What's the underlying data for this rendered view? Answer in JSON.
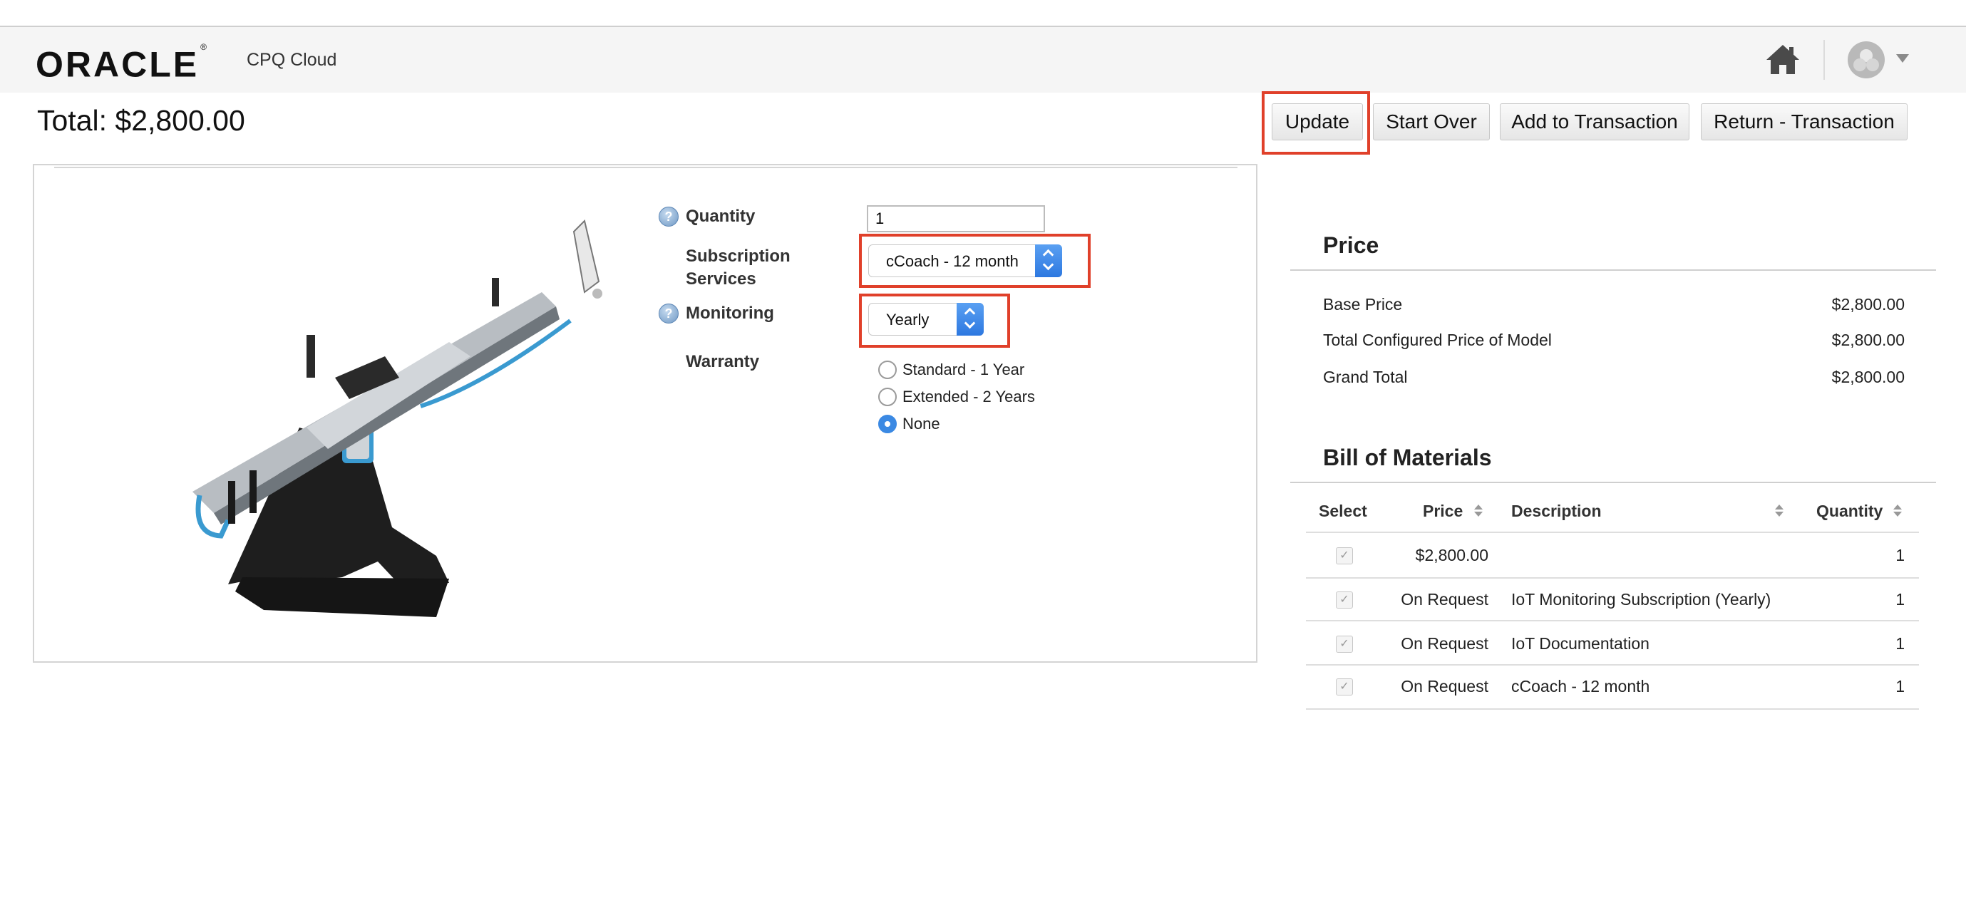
{
  "header": {
    "logo_text": "ORACLE",
    "logo_mark": "®",
    "app_name": "CPQ Cloud",
    "icons": [
      "home-icon",
      "user-avatar-icon",
      "caret-down-icon"
    ]
  },
  "total": {
    "label": "Total: $2,800.00"
  },
  "actions": {
    "update": "Update",
    "start_over": "Start Over",
    "add_to_transaction": "Add to Transaction",
    "return_transaction": "Return - Transaction"
  },
  "config": {
    "quantity_label": "Quantity",
    "quantity_value": "1",
    "subscription_label_1": "Subscription",
    "subscription_label_2": "Services",
    "subscription_value": "cCoach - 12 month",
    "monitoring_label": "Monitoring",
    "monitoring_value": "Yearly",
    "warranty_label": "Warranty",
    "warranty_options": [
      {
        "label": "Standard - 1 Year",
        "selected": false
      },
      {
        "label": "Extended - 2 Years",
        "selected": false
      },
      {
        "label": "None",
        "selected": true
      }
    ],
    "help_icon_glyph": "?"
  },
  "price": {
    "title": "Price",
    "rows": [
      {
        "label": "Base Price",
        "value": "$2,800.00"
      },
      {
        "label": "Total Configured Price of Model",
        "value": "$2,800.00"
      },
      {
        "label": "Grand Total",
        "value": "$2,800.00"
      }
    ]
  },
  "bom": {
    "title": "Bill of Materials",
    "columns": [
      "Select",
      "Price",
      "Description",
      "Quantity"
    ],
    "rows": [
      {
        "price": "$2,800.00",
        "description": "",
        "quantity": "1"
      },
      {
        "price": "On Request",
        "description": "IoT Monitoring Subscription (Yearly)",
        "quantity": "1"
      },
      {
        "price": "On Request",
        "description": "IoT Documentation",
        "quantity": "1"
      },
      {
        "price": "On Request",
        "description": "cCoach - 12 month",
        "quantity": "1"
      }
    ],
    "check_glyph": "✓"
  },
  "colors": {
    "highlight": "#e0402a",
    "select_accent": "#2d78e0",
    "header_bg": "#f5f5f5"
  }
}
